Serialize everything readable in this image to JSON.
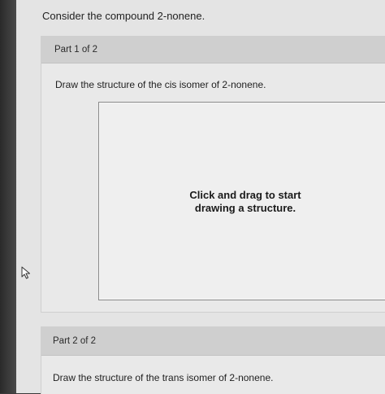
{
  "question": {
    "prompt": "Consider the compound 2-nonene."
  },
  "parts": [
    {
      "header": "Part 1 of 2",
      "instruction": "Draw the structure of the cis isomer of 2-nonene.",
      "canvas_hint_line1": "Click and drag to start",
      "canvas_hint_line2": "drawing a structure."
    },
    {
      "header": "Part 2 of 2",
      "instruction": "Draw the structure of the trans isomer of 2-nonene."
    }
  ],
  "icons": {
    "cursor": "mouse-pointer-icon"
  }
}
